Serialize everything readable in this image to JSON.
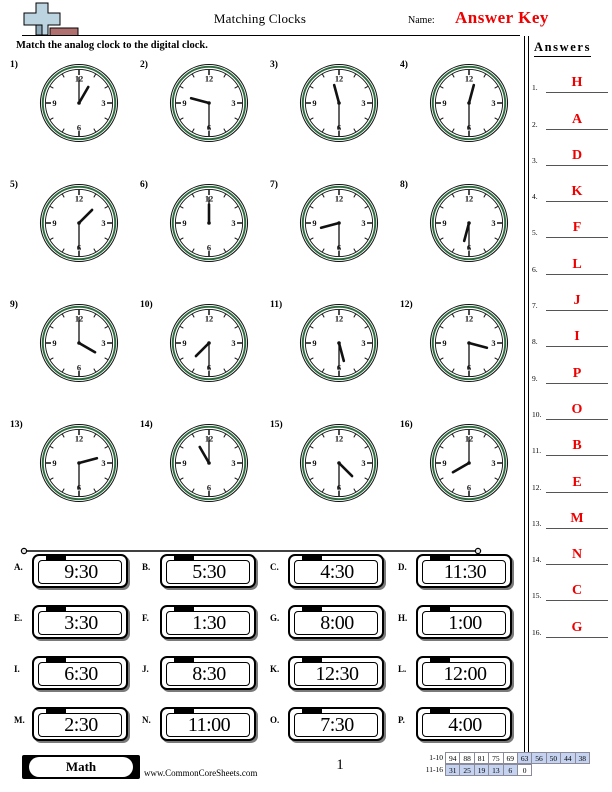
{
  "header": {
    "title": "Matching Clocks",
    "name_label": "Name:",
    "answer_key": "Answer Key",
    "logo_icon": "commoncoresheets-plus-logo"
  },
  "instructions": "Match the analog clock to the digital clock.",
  "answers_panel": {
    "title": "Answers",
    "items": [
      {
        "num": "1.",
        "value": "H"
      },
      {
        "num": "2.",
        "value": "A"
      },
      {
        "num": "3.",
        "value": "D"
      },
      {
        "num": "4.",
        "value": "K"
      },
      {
        "num": "5.",
        "value": "F"
      },
      {
        "num": "6.",
        "value": "L"
      },
      {
        "num": "7.",
        "value": "J"
      },
      {
        "num": "8.",
        "value": "I"
      },
      {
        "num": "9.",
        "value": "P"
      },
      {
        "num": "10.",
        "value": "O"
      },
      {
        "num": "11.",
        "value": "B"
      },
      {
        "num": "12.",
        "value": "E"
      },
      {
        "num": "13.",
        "value": "M"
      },
      {
        "num": "14.",
        "value": "N"
      },
      {
        "num": "15.",
        "value": "C"
      },
      {
        "num": "16.",
        "value": "G"
      }
    ]
  },
  "clock_face": {
    "ring_color": "#2d6b3f",
    "numerals": [
      "12",
      "3",
      "6",
      "9"
    ]
  },
  "analog_clocks": [
    {
      "num": "1)",
      "hour": 1,
      "minute": 0
    },
    {
      "num": "2)",
      "hour": 9,
      "minute": 30
    },
    {
      "num": "3)",
      "hour": 11,
      "minute": 30
    },
    {
      "num": "4)",
      "hour": 12,
      "minute": 30
    },
    {
      "num": "5)",
      "hour": 1,
      "minute": 30
    },
    {
      "num": "6)",
      "hour": 12,
      "minute": 0
    },
    {
      "num": "7)",
      "hour": 8,
      "minute": 30
    },
    {
      "num": "8)",
      "hour": 6,
      "minute": 30
    },
    {
      "num": "9)",
      "hour": 4,
      "minute": 0
    },
    {
      "num": "10)",
      "hour": 7,
      "minute": 30
    },
    {
      "num": "11)",
      "hour": 5,
      "minute": 30
    },
    {
      "num": "12)",
      "hour": 3,
      "minute": 30
    },
    {
      "num": "13)",
      "hour": 2,
      "minute": 30
    },
    {
      "num": "14)",
      "hour": 11,
      "minute": 0
    },
    {
      "num": "15)",
      "hour": 4,
      "minute": 30
    },
    {
      "num": "16)",
      "hour": 8,
      "minute": 0
    }
  ],
  "digital_clocks": [
    {
      "letter": "A.",
      "time": "9:30"
    },
    {
      "letter": "B.",
      "time": "5:30"
    },
    {
      "letter": "C.",
      "time": "4:30"
    },
    {
      "letter": "D.",
      "time": "11:30"
    },
    {
      "letter": "E.",
      "time": "3:30"
    },
    {
      "letter": "F.",
      "time": "1:30"
    },
    {
      "letter": "G.",
      "time": "8:00"
    },
    {
      "letter": "H.",
      "time": "1:00"
    },
    {
      "letter": "I.",
      "time": "6:30"
    },
    {
      "letter": "J.",
      "time": "8:30"
    },
    {
      "letter": "K.",
      "time": "12:30"
    },
    {
      "letter": "L.",
      "time": "12:00"
    },
    {
      "letter": "M.",
      "time": "2:30"
    },
    {
      "letter": "N.",
      "time": "11:00"
    },
    {
      "letter": "O.",
      "time": "7:30"
    },
    {
      "letter": "P.",
      "time": "4:00"
    }
  ],
  "footer": {
    "subject": "Math",
    "url": "www.CommonCoreSheets.com",
    "page_number": "1",
    "scale": {
      "row1_label": "1-10",
      "row2_label": "11-16",
      "row1": [
        {
          "v": "94",
          "hl": false
        },
        {
          "v": "88",
          "hl": false
        },
        {
          "v": "81",
          "hl": false
        },
        {
          "v": "75",
          "hl": false
        },
        {
          "v": "69",
          "hl": false
        },
        {
          "v": "63",
          "hl": true
        },
        {
          "v": "56",
          "hl": true
        },
        {
          "v": "50",
          "hl": true
        },
        {
          "v": "44",
          "hl": true
        },
        {
          "v": "38",
          "hl": true
        }
      ],
      "row2": [
        {
          "v": "31",
          "hl": true
        },
        {
          "v": "25",
          "hl": true
        },
        {
          "v": "19",
          "hl": true
        },
        {
          "v": "13",
          "hl": true
        },
        {
          "v": "6",
          "hl": true
        },
        {
          "v": "0",
          "hl": false
        }
      ]
    },
    "highlight_color": "#c5d3f0"
  }
}
